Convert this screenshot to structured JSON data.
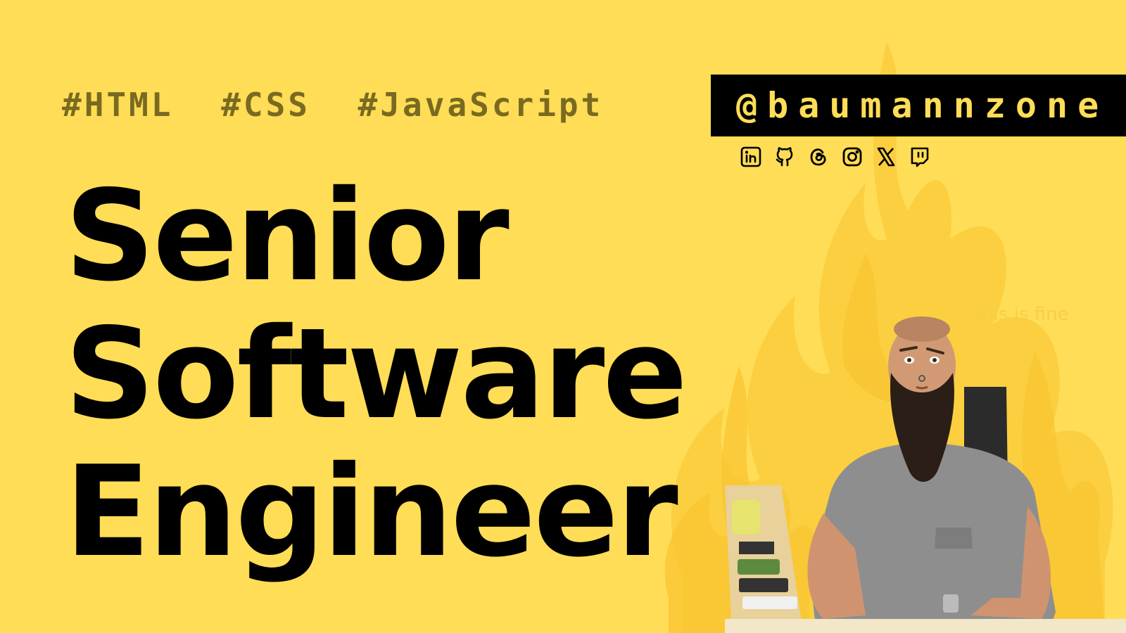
{
  "hashtags": [
    "#HTML",
    "#CSS",
    "#JavaScript"
  ],
  "headline": {
    "line1": "Senior",
    "line2": "Software",
    "line3": "Engineer"
  },
  "handle": "@baumannzone",
  "socials": [
    {
      "icon": "linkedin-icon"
    },
    {
      "icon": "github-icon"
    },
    {
      "icon": "threads-icon"
    },
    {
      "icon": "instagram-icon"
    },
    {
      "icon": "x-icon"
    },
    {
      "icon": "twitch-icon"
    }
  ],
  "caption": "this is fine",
  "colors": {
    "background": "#FFDD57",
    "headline": "#000000",
    "hashtag": "#7A6A20",
    "handle_bg": "#000000",
    "handle_text": "#FFDD57",
    "flame": "#FBCB3A"
  }
}
